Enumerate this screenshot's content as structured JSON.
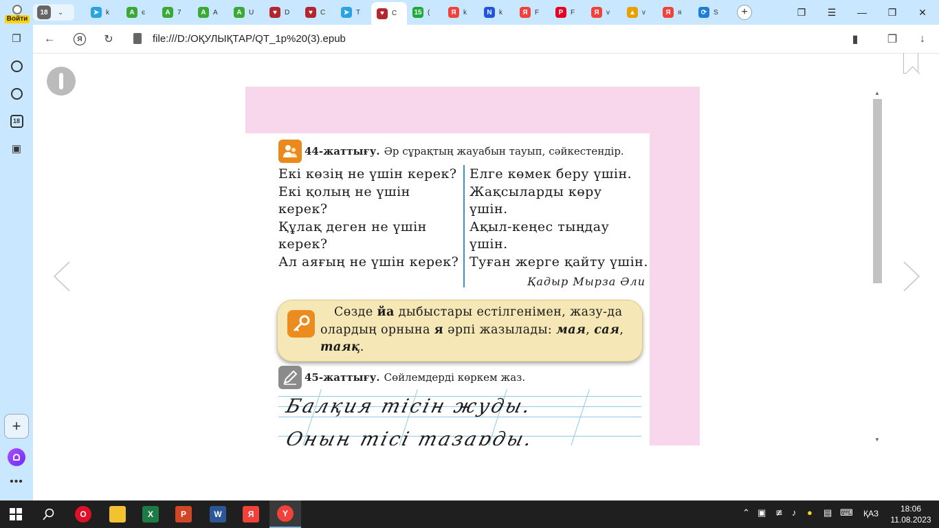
{
  "browser": {
    "login_label": "Войти",
    "tab_count": "18",
    "tabs": [
      {
        "letter": "k",
        "color": "#2aa3e0",
        "glyph": "➤"
      },
      {
        "letter": "є",
        "color": "#3aa935",
        "glyph": "A"
      },
      {
        "letter": "7",
        "color": "#3aa935",
        "glyph": "A"
      },
      {
        "letter": "A",
        "color": "#3aa935",
        "glyph": "A"
      },
      {
        "letter": "U",
        "color": "#3aa935",
        "glyph": "A"
      },
      {
        "letter": "D",
        "color": "#b3262e",
        "glyph": "♥"
      },
      {
        "letter": "C",
        "color": "#b3262e",
        "glyph": "♥"
      },
      {
        "letter": "T",
        "color": "#2aa3e0",
        "glyph": "➤"
      },
      {
        "letter": "C",
        "color": "#b3262e",
        "glyph": "♥"
      },
      {
        "letter": "(",
        "color": "#1faa3c",
        "glyph": "15"
      },
      {
        "letter": "k",
        "color": "#f0423a",
        "glyph": "Я"
      },
      {
        "letter": "k",
        "color": "#2255dd",
        "glyph": "N"
      },
      {
        "letter": "F",
        "color": "#f0423a",
        "glyph": "Я"
      },
      {
        "letter": "F",
        "color": "#e60023",
        "glyph": "P"
      },
      {
        "letter": "v",
        "color": "#f0423a",
        "glyph": "Я"
      },
      {
        "letter": "v",
        "color": "#e8a000",
        "glyph": "▲"
      },
      {
        "letter": "я",
        "color": "#f0423a",
        "glyph": "Я"
      },
      {
        "letter": "S",
        "color": "#1c7ed6",
        "glyph": "⟳"
      }
    ],
    "url": "file:///D:/ОҚУЛЫҚТАР/QT_1p%20(3).epub"
  },
  "sidebar": {
    "counter_badge": "18"
  },
  "book": {
    "ex44": {
      "number": "44-жаттығу.",
      "instruction": "Әр сұрақтың жауабын тауып, сәйкестендір."
    },
    "questions": [
      "Екі көзің не үшін керек?",
      "Екі қолың не үшін",
      "керек?",
      "Құлақ деген не үшін",
      "керек?",
      "Ал аяғың не үшін керек?"
    ],
    "answers": [
      "Елге көмек беру үшін.",
      "Жақсыларды көру",
      "үшін.",
      "Ақыл-кеңес тыңдау",
      "үшін.",
      "Туған жерге қайту үшін."
    ],
    "author": "Қадыр Мырза Әли",
    "rule": {
      "p1": "Сөзде ",
      "b1": "йа",
      "p2": " дыбыстары естілгенімен, жазу-да олардың орнына ",
      "b2": "я",
      "p3": " әрпі жазылады: ",
      "e1": "мая",
      "p4": ", ",
      "e2": "сая",
      "p5": ", ",
      "e3": "таяқ",
      "p6": "."
    },
    "ex45": {
      "number": "45-жаттығу.",
      "instruction": "Сөйлемдерді көркем жаз."
    },
    "handwriting": [
      "Балқия тісін жуды.",
      "Оның тісі тазарды."
    ]
  },
  "taskbar": {
    "lang": "ҚАЗ",
    "time": "18:06",
    "date": "11.08.2023"
  }
}
